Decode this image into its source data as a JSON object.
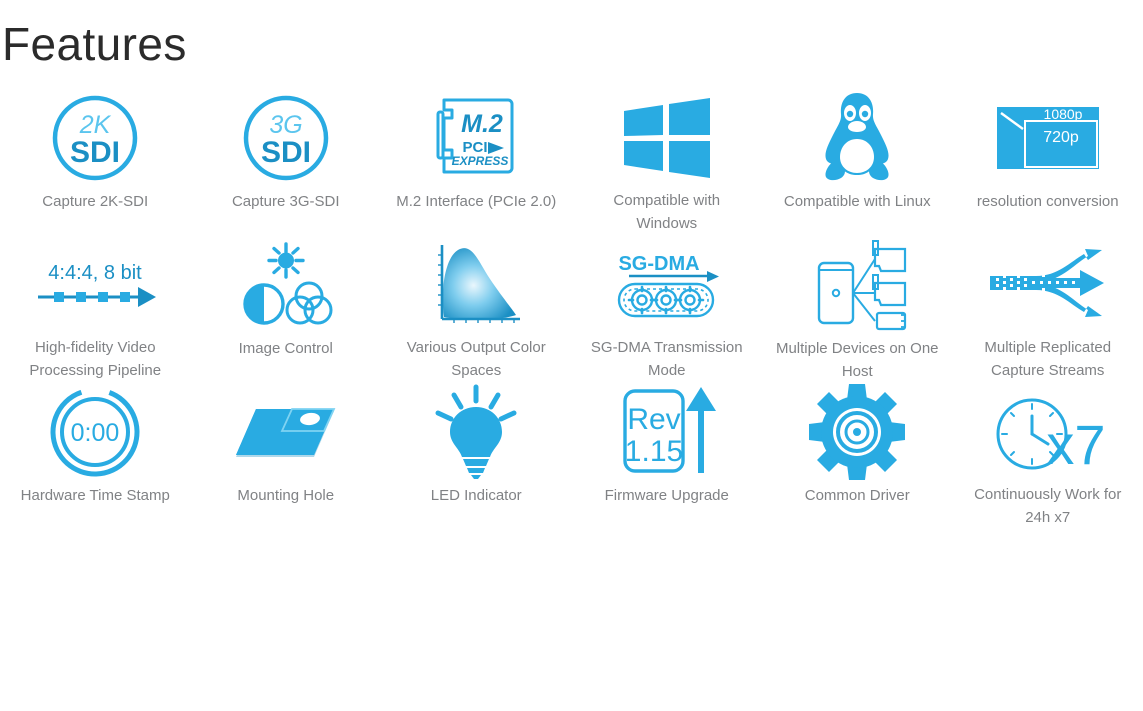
{
  "page": {
    "title": "Features",
    "accent_color": "#29abe2",
    "accent_dark": "#1b8fc4",
    "caption_color": "#808285",
    "title_color": "#2b2b2b",
    "background": "#ffffff"
  },
  "features": [
    {
      "id": "capture-2k-sdi",
      "icon": "2k-sdi-badge-icon",
      "label": "Capture 2K-SDI",
      "icon_text": {
        "top": "2K",
        "bottom": "SDI"
      }
    },
    {
      "id": "capture-3g-sdi",
      "icon": "3g-sdi-badge-icon",
      "label": "Capture 3G-SDI",
      "icon_text": {
        "top": "3G",
        "bottom": "SDI"
      }
    },
    {
      "id": "m2-interface",
      "icon": "m2-card-icon",
      "label": "M.2 Interface (PCIe 2.0)",
      "icon_text": {
        "top": "M.2",
        "bottom": "PCI",
        "bottom2": "EXPRESS"
      }
    },
    {
      "id": "compatible-windows",
      "icon": "windows-logo-icon",
      "label": "Compatible with Windows",
      "icon_text": {}
    },
    {
      "id": "compatible-linux",
      "icon": "linux-penguin-icon",
      "label": "Compatible with Linux",
      "icon_text": {}
    },
    {
      "id": "resolution-conversion",
      "icon": "resolution-conversion-icon",
      "label": "resolution conversion",
      "icon_text": {
        "top": "1080p",
        "bottom": "720p"
      }
    },
    {
      "id": "high-fidelity-pipeline",
      "icon": "pipeline-arrow-icon",
      "label": "High-fidelity Video Processing Pipeline",
      "icon_text": {
        "top": "4:4:4, 8 bit"
      }
    },
    {
      "id": "image-control",
      "icon": "image-control-icon",
      "label": "Image Control",
      "icon_text": {}
    },
    {
      "id": "output-color-spaces",
      "icon": "cie-chromaticity-icon",
      "label": "Various Output Color Spaces",
      "icon_text": {}
    },
    {
      "id": "sg-dma-mode",
      "icon": "sg-dma-gears-icon",
      "label": "SG-DMA Transmission Mode",
      "icon_text": {
        "top": "SG-DMA"
      }
    },
    {
      "id": "multiple-devices",
      "icon": "multiple-devices-host-icon",
      "label": "Multiple Devices on One Host",
      "icon_text": {}
    },
    {
      "id": "replicated-streams",
      "icon": "replicated-streams-icon",
      "label": "Multiple Replicated Capture Streams",
      "icon_text": {}
    },
    {
      "id": "hardware-time-stamp",
      "icon": "stopwatch-icon",
      "label": "Hardware Time Stamp",
      "icon_text": {
        "top": "0:00"
      }
    },
    {
      "id": "mounting-hole",
      "icon": "mounting-hole-icon",
      "label": "Mounting Hole",
      "icon_text": {}
    },
    {
      "id": "led-indicator",
      "icon": "light-bulb-icon",
      "label": "LED Indicator",
      "icon_text": {}
    },
    {
      "id": "firmware-upgrade",
      "icon": "firmware-upgrade-icon",
      "label": "Firmware Upgrade",
      "icon_text": {
        "top": "Rev",
        "bottom": "1.15"
      }
    },
    {
      "id": "common-driver",
      "icon": "gear-icon",
      "label": "Common Driver",
      "icon_text": {}
    },
    {
      "id": "continuous-operation",
      "icon": "clock-x7-icon",
      "label": "Continuously Work for 24h x7",
      "icon_text": {
        "top": "x7"
      }
    }
  ]
}
